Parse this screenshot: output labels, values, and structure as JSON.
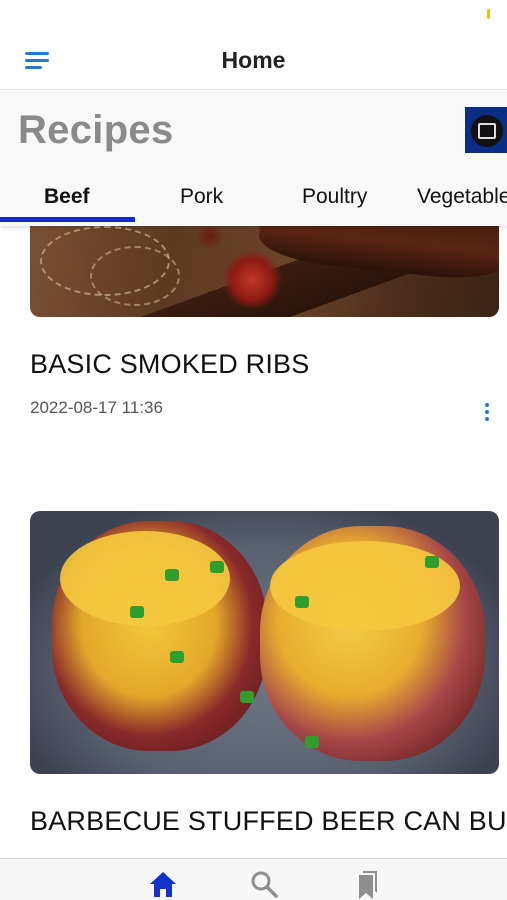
{
  "app_bar": {
    "title": "Home",
    "menu_icon": "hamburger-menu-icon"
  },
  "header": {
    "title": "Recipes",
    "logo_icon": "recipe-book-logo-icon"
  },
  "tabs": [
    {
      "label": "Beef",
      "active": true
    },
    {
      "label": "Pork",
      "active": false
    },
    {
      "label": "Poultry",
      "active": false
    },
    {
      "label": "Vegetables",
      "active": false
    }
  ],
  "recipes": [
    {
      "title": "BASIC SMOKED RIBS",
      "date": "2022-08-17 11:36",
      "image": "smoked-ribs-photo"
    },
    {
      "title": "BARBECUE STUFFED BEER CAN BURGERS",
      "image": "stuffed-burgers-photo"
    }
  ],
  "bottom_nav": [
    {
      "icon": "home-icon",
      "active": true
    },
    {
      "icon": "search-icon",
      "active": false
    },
    {
      "icon": "bookmarks-icon",
      "active": false
    }
  ],
  "colors": {
    "accent": "#1327d6",
    "link_blue": "#1e7ad6",
    "header_bg": "#f8f8f8",
    "title_gray": "#8a8a8a",
    "active_nav": "#1133cc",
    "inactive_nav": "#8e8e8e"
  }
}
